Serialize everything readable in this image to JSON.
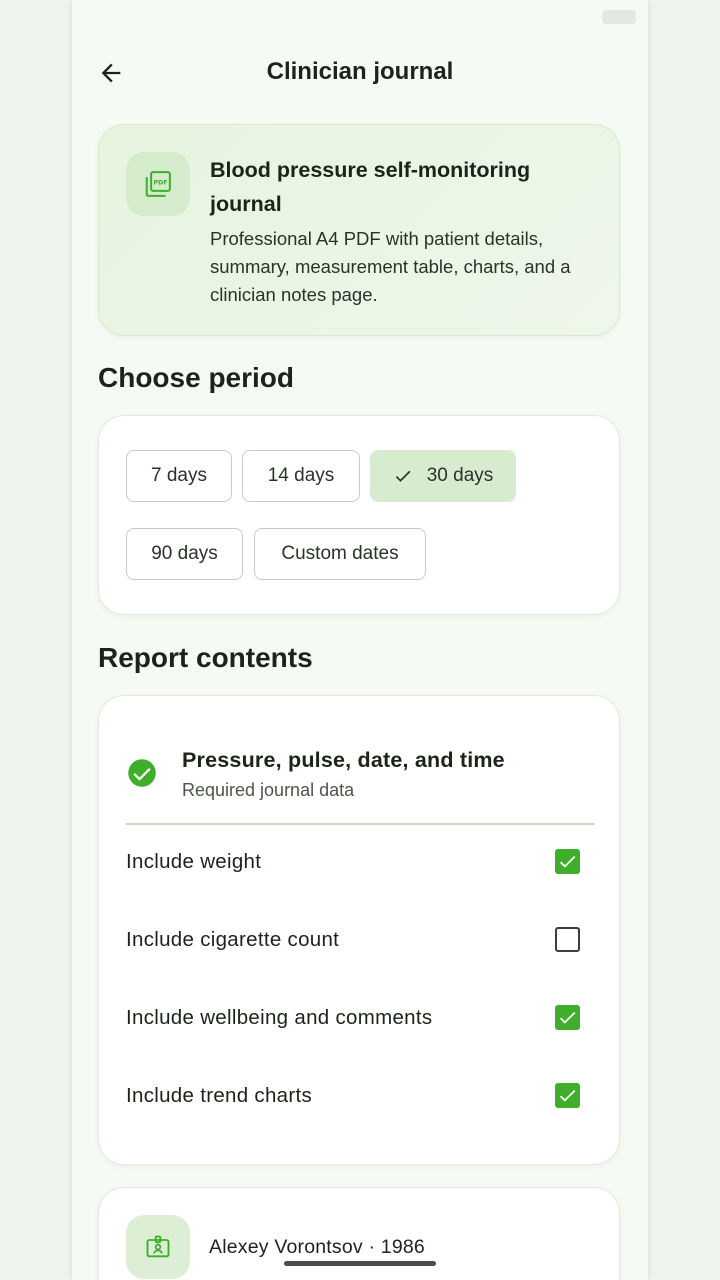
{
  "header": {
    "title": "Clinician journal"
  },
  "info_card": {
    "icon": "pdf-document-icon",
    "title": "Blood pressure self-monitoring journal",
    "description": "Professional A4 PDF with patient details, summary, measurement table, charts, and a clinician notes page."
  },
  "period": {
    "section_title": "Choose period",
    "chips": [
      {
        "label": "7 days",
        "selected": false
      },
      {
        "label": "14 days",
        "selected": false
      },
      {
        "label": "30 days",
        "selected": true
      },
      {
        "label": "90 days",
        "selected": false
      },
      {
        "label": "Custom dates",
        "selected": false
      }
    ]
  },
  "contents": {
    "section_title": "Report contents",
    "required": {
      "title": "Pressure, pulse, date, and time",
      "subtitle": "Required journal data"
    },
    "options": [
      {
        "label": "Include weight",
        "checked": true
      },
      {
        "label": "Include cigarette count",
        "checked": false
      },
      {
        "label": "Include wellbeing and comments",
        "checked": true
      },
      {
        "label": "Include trend charts",
        "checked": true
      }
    ]
  },
  "patient": {
    "icon": "id-badge-icon",
    "text": "Alexey Vorontsov · 1986"
  },
  "colors": {
    "accent": "#3fae2a",
    "selected_chip": "#d7ebcf",
    "info_card_bg": "#e6f4df"
  }
}
